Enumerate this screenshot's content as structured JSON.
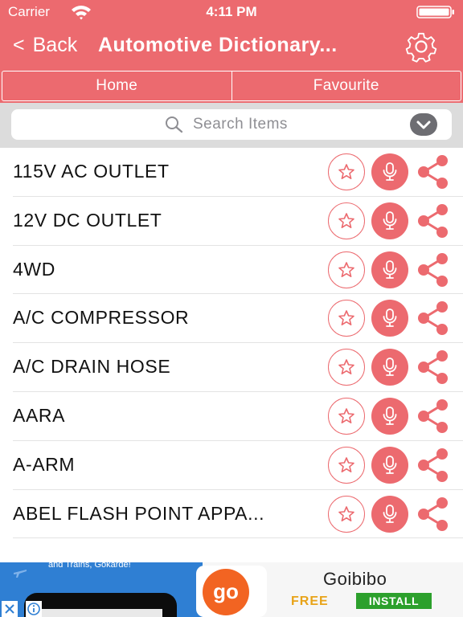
{
  "colors": {
    "accent": "#ec6a6f",
    "search_bg": "#dcdcdc",
    "divider": "#e3e3e3"
  },
  "status_bar": {
    "carrier": "Carrier",
    "time": "4:11 PM"
  },
  "nav": {
    "back_label": "Back",
    "title": "Automotive Dictionary...",
    "settings_icon": "gear-icon"
  },
  "tabs": [
    {
      "label": "Home"
    },
    {
      "label": "Favourite"
    }
  ],
  "search": {
    "placeholder": "Search Items",
    "value": ""
  },
  "list": {
    "items": [
      {
        "term": "115V AC OUTLET"
      },
      {
        "term": "12V DC OUTLET"
      },
      {
        "term": "4WD"
      },
      {
        "term": "A/C COMPRESSOR"
      },
      {
        "term": "A/C DRAIN HOSE"
      },
      {
        "term": "AARA"
      },
      {
        "term": "A-ARM"
      },
      {
        "term": "ABEL FLASH POINT APPA..."
      }
    ],
    "icons": {
      "favourite": "star-icon",
      "speak": "microphone-icon",
      "share": "share-icon"
    }
  },
  "ad": {
    "tagline": "and Trains, Gokarde!",
    "logo_text": "go",
    "brand": "Goibibo",
    "free_label": "FREE",
    "install_label": "INSTALL",
    "colors": {
      "left_bg": "#2f7fd3",
      "logo": "#f26422",
      "free": "#e8a318",
      "install": "#2ca02c"
    }
  }
}
